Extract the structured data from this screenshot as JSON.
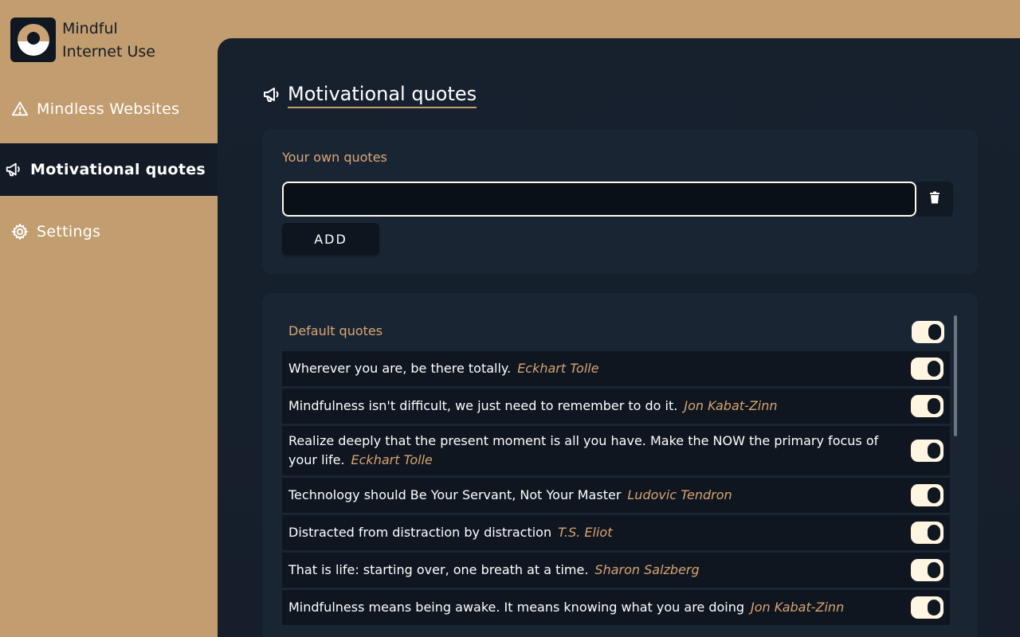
{
  "brand": {
    "line1": "Mindful",
    "line2": "Internet Use"
  },
  "nav": [
    {
      "label": "Mindless Websites",
      "icon": "warning-icon",
      "active": false
    },
    {
      "label": "Motivational quotes",
      "icon": "megaphone-icon",
      "active": true
    },
    {
      "label": "Settings",
      "icon": "gear-icon",
      "active": false
    }
  ],
  "page": {
    "title": "Motivational quotes"
  },
  "own_quotes": {
    "label": "Your own quotes",
    "input_value": "",
    "add_label": "ADD"
  },
  "default_quotes": {
    "label": "Default quotes",
    "enabled": true,
    "items": [
      {
        "quote": "Wherever you are, be there totally.",
        "author": "Eckhart Tolle",
        "enabled": true
      },
      {
        "quote": "Mindfulness isn't difficult, we just need to remember to do it.",
        "author": "Jon Kabat-Zinn",
        "enabled": true
      },
      {
        "quote": "Realize deeply that the present moment is all you have. Make the NOW the primary focus of your life.",
        "author": "Eckhart Tolle",
        "enabled": true
      },
      {
        "quote": "Technology should Be Your Servant, Not Your Master",
        "author": "Ludovic Tendron",
        "enabled": true
      },
      {
        "quote": "Distracted from distraction by distraction",
        "author": "T.S. Eliot",
        "enabled": true
      },
      {
        "quote": "That is life: starting over, one breath at a time.",
        "author": "Sharon Salzberg",
        "enabled": true
      },
      {
        "quote": "Mindfulness means being awake. It means knowing what you are doing",
        "author": "Jon Kabat-Zinn",
        "enabled": true
      }
    ]
  },
  "colors": {
    "sidebar_bg": "#c29d70",
    "panel_bg": "#17212e",
    "accent": "#d9a877"
  }
}
